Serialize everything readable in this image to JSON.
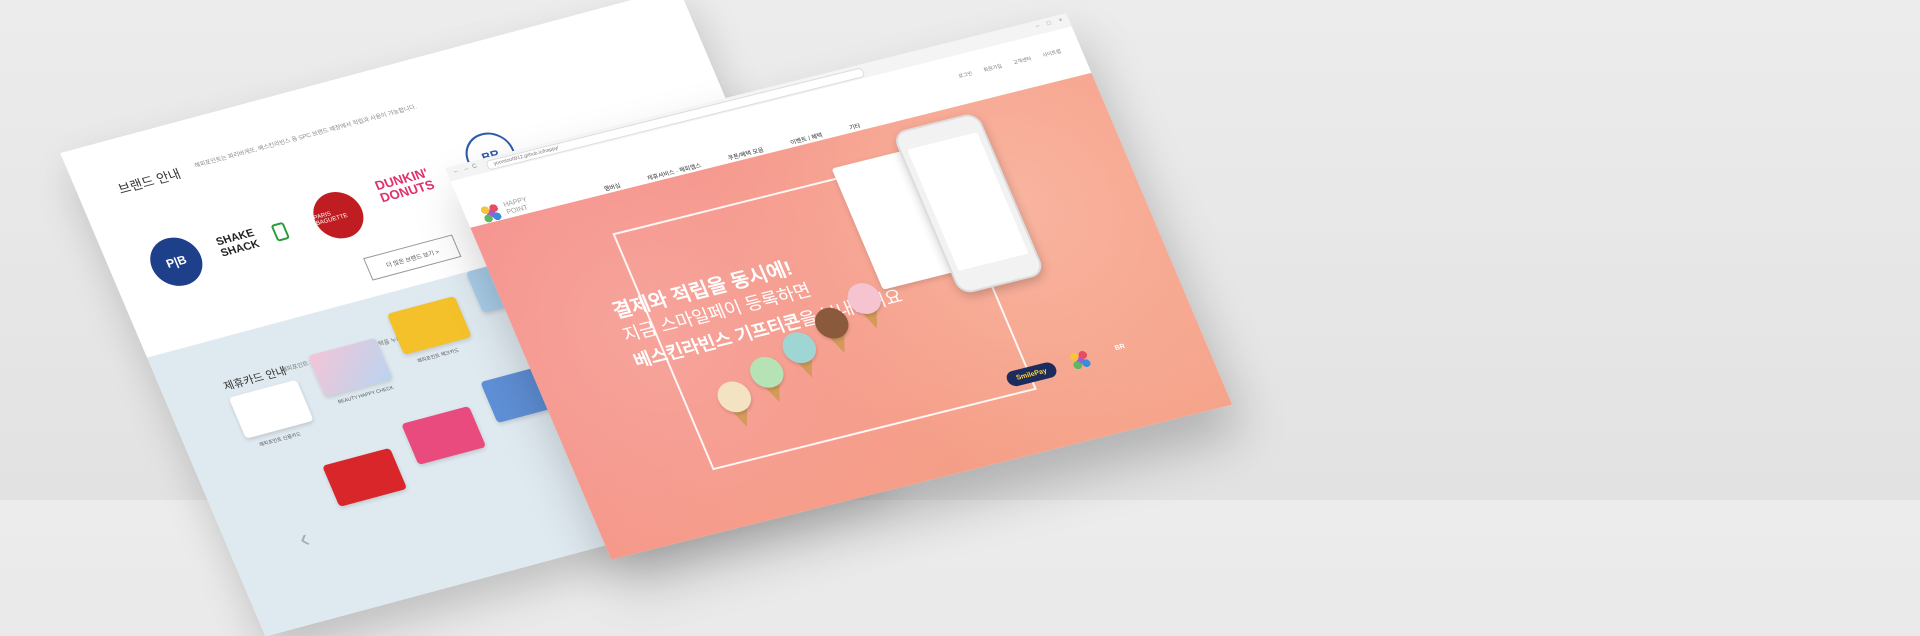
{
  "back_page": {
    "brand_section": {
      "title": "브랜드 안내",
      "description": "해피포인트는 파리바게뜨, 배스킨라빈스 등 SPC 브랜드 매장에서 적립과 사용이 가능합니다.",
      "logos": [
        {
          "name": "paris-croissant-logo",
          "text": "P|B"
        },
        {
          "name": "shake-shack-logo",
          "text": "SHAKE SHACK"
        },
        {
          "name": "paris-baguette-logo",
          "text": "PARIS BAGUETTE"
        },
        {
          "name": "dunkin-donuts-logo",
          "text": "DUNKIN' DONUTS"
        },
        {
          "name": "baskin-robbins-logo",
          "text": "BR"
        }
      ],
      "more_button": "더 많은 브랜드 보기 >"
    },
    "cards_section": {
      "title": "제휴카드 안내",
      "description": "해피포인트 제휴카드로 결제하고 적립 혜택을 누리세요.",
      "captions": [
        "해피포인트 신용카드",
        "BEAUTY HAPPY CHECK",
        "해피포인트 체크카드"
      ],
      "prev_arrow": "‹"
    }
  },
  "front_page": {
    "browser": {
      "url": "yoonsoo0912.github.io/happy/",
      "nav_icons": [
        "←",
        "→",
        "C"
      ],
      "window_controls": [
        "–",
        "□",
        "×"
      ]
    },
    "top_links": [
      "로그인",
      "회원가입",
      "고객센터",
      "사이트맵"
    ],
    "logo": {
      "line1": "HAPPY",
      "line2": "POINT"
    },
    "menu": [
      "멤버십",
      "제휴서비스 · 해피앱스",
      "쿠폰/혜택 모음",
      "이벤트 / 혜택",
      "기타"
    ],
    "hero": {
      "headline_line1": "결제와 적립을 동시에!",
      "headline_line2": "지금 스마일페이 등록하면",
      "headline_line3_bold": "베스킨라빈스 기프티콘",
      "headline_line3_rest": "을 보내드려요"
    },
    "badges": {
      "smilepay": "SmilePay",
      "happypoint": "HAPPY POINT",
      "baskin": "BR"
    },
    "colors": {
      "hero_start": "#f48b8b",
      "hero_end": "#f5a48a",
      "accent_pink": "#e94b7f",
      "smilepay_navy": "#1b2c5d"
    }
  }
}
